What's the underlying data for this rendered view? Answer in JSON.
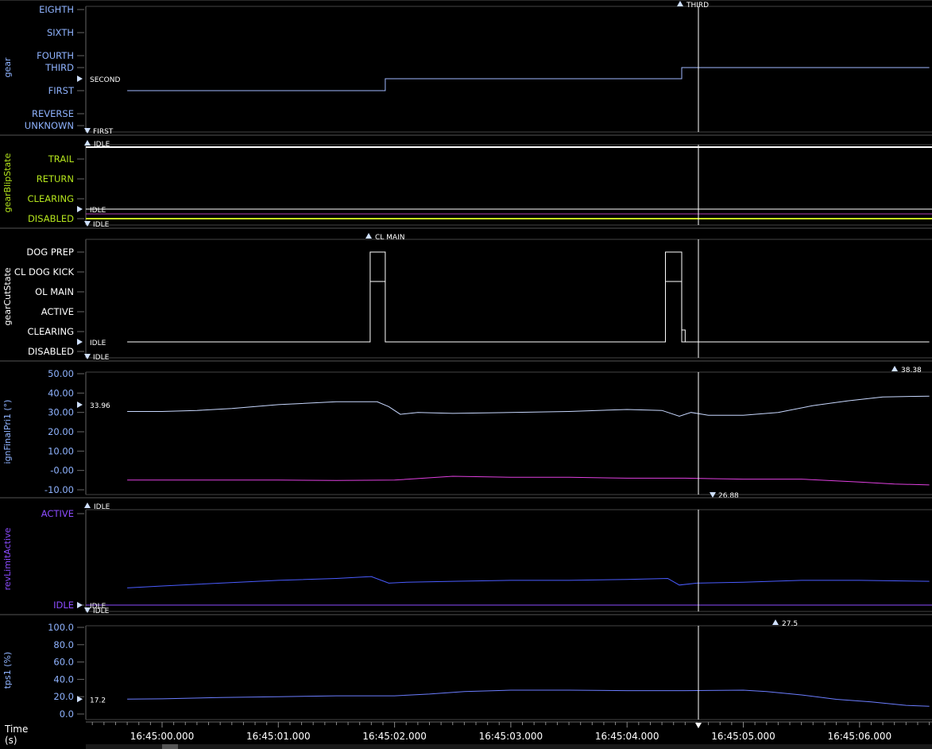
{
  "time_axis": {
    "label_line1": "Time",
    "label_line2": "(s)",
    "ticks": [
      "16:45:00.000",
      "16:45:01.000",
      "16:45:02.000",
      "16:45:03.000",
      "16:45:04.000",
      "16:45:05.000",
      "16:45:06.000"
    ]
  },
  "chart_data": [
    {
      "type": "line",
      "name": "gear",
      "ylabel": "gear",
      "label_color": "#8fb3ff",
      "y_categories": [
        "UNKNOWN",
        "REVERSE",
        "FIRST",
        "FOURTH",
        "THIRD",
        "SIXTH",
        "EIGHTH"
      ],
      "series": [
        {
          "color": "#9fb8ff",
          "x": [
            -0.3,
            1.92,
            1.92,
            4.47,
            4.47,
            6.6
          ],
          "y": [
            "FIRST",
            "FIRST",
            "SECOND",
            "SECOND",
            "THIRD",
            "THIRD"
          ]
        }
      ],
      "annotations": {
        "top": "THIRD",
        "cursor": "SECOND",
        "bottom": "FIRST"
      }
    },
    {
      "type": "line",
      "name": "gearBlipState",
      "ylabel": "gearBlipState",
      "label_color": "#b5e61d",
      "y_categories": [
        "DISABLED",
        "CLEARING",
        "RETURN",
        "TRAIL"
      ],
      "series": [
        {
          "color": "#ffffff",
          "y_constant": "IDLE"
        }
      ],
      "annotations": {
        "top": "IDLE",
        "cursor": "IDLE",
        "bottom": "IDLE"
      }
    },
    {
      "type": "line",
      "name": "gearCutState",
      "ylabel": "gearCutState",
      "label_color": "#ffffff",
      "y_categories": [
        "DISABLED",
        "CLEARING",
        "ACTIVE",
        "OL MAIN",
        "CL DOG KICK",
        "DOG PREP"
      ],
      "series": [
        {
          "color": "#ffffff",
          "x": [
            -0.3,
            1.79,
            1.79,
            1.92,
            1.92,
            4.33,
            4.33,
            4.47,
            4.47,
            6.6
          ],
          "y": [
            "IDLE",
            "IDLE",
            "DOG PREP",
            "DOG PREP",
            "IDLE",
            "IDLE",
            "DOG PREP",
            "DOG PREP",
            "IDLE",
            "IDLE"
          ]
        }
      ],
      "annotations": {
        "top": "CL MAIN",
        "cursor": "IDLE",
        "bottom": "IDLE"
      }
    },
    {
      "type": "line",
      "name": "ignFinalPri1",
      "ylabel": "ignFinalPri1 (°)",
      "label_color": "#8fb3ff",
      "ylim": [
        -10,
        50
      ],
      "yticks": [
        "50.00",
        "40.00",
        "30.00",
        "20.00",
        "10.00",
        "-0.00",
        "-10.00"
      ],
      "series": [
        {
          "color": "#c8d8ff",
          "x": [
            -0.3,
            0.0,
            0.3,
            0.6,
            1.0,
            1.5,
            1.85,
            1.95,
            2.05,
            2.2,
            2.5,
            3.0,
            3.5,
            4.0,
            4.3,
            4.45,
            4.55,
            4.7,
            5.0,
            5.3,
            5.6,
            5.9,
            6.2,
            6.6
          ],
          "y": [
            30.5,
            30.5,
            31,
            32,
            34,
            35.5,
            35.5,
            33,
            29,
            30,
            29.5,
            30,
            30.5,
            31.5,
            31,
            28,
            30,
            28.5,
            28.5,
            30,
            33.5,
            36,
            38,
            38.4
          ]
        },
        {
          "color": "#e040e0",
          "x": [
            -0.3,
            0.5,
            1.0,
            1.5,
            2.0,
            2.5,
            3.0,
            3.5,
            4.0,
            4.5,
            5.0,
            5.5,
            6.0,
            6.3,
            6.6
          ],
          "y": [
            -5,
            -5,
            -5,
            -5.2,
            -5,
            -3,
            -3.5,
            -3.5,
            -4,
            -4,
            -4.5,
            -4.5,
            -6,
            -7,
            -7.5
          ]
        }
      ],
      "annotations": {
        "top": "38.38",
        "cursor": "33.96",
        "bottom": "26.88"
      }
    },
    {
      "type": "line",
      "name": "revLimitActive",
      "ylabel": "revLimitActive",
      "label_color": "#8c4cff",
      "y_categories": [
        "IDLE",
        "ACTIVE"
      ],
      "series": [
        {
          "color": "#4a5cff",
          "x": [
            -0.3,
            0.0,
            0.5,
            1.0,
            1.5,
            1.8,
            1.95,
            2.1,
            2.5,
            3.0,
            3.5,
            4.0,
            4.35,
            4.45,
            4.6,
            5.0,
            5.5,
            6.0,
            6.6
          ],
          "y": [
            0.19,
            0.21,
            0.24,
            0.27,
            0.29,
            0.31,
            0.24,
            0.25,
            0.26,
            0.27,
            0.27,
            0.28,
            0.29,
            0.22,
            0.24,
            0.25,
            0.27,
            0.27,
            0.26
          ]
        },
        {
          "color": "#8c4cff",
          "y_constant": "IDLE"
        }
      ],
      "annotations": {
        "top": "IDLE",
        "cursor": "IDLE",
        "bottom": "IDLE"
      }
    },
    {
      "type": "line",
      "name": "tps1",
      "ylabel": "tps1 (%)",
      "label_color": "#8fb3ff",
      "ylim": [
        0,
        100
      ],
      "yticks": [
        "100.0",
        "80.0",
        "60.0",
        "40.0",
        "20.0",
        "0.0"
      ],
      "series": [
        {
          "color": "#6b7dff",
          "x": [
            -0.3,
            0.0,
            0.5,
            1.0,
            1.5,
            2.0,
            2.3,
            2.6,
            3.0,
            3.5,
            4.0,
            4.5,
            5.0,
            5.2,
            5.5,
            5.8,
            6.1,
            6.4,
            6.6
          ],
          "y": [
            17.2,
            17.5,
            19,
            20,
            21,
            21,
            23,
            26,
            27.5,
            27.5,
            27,
            27,
            27.5,
            26,
            22,
            17,
            14,
            10,
            9
          ]
        }
      ],
      "annotations": {
        "top": "27.5",
        "cursor": "17.2"
      }
    }
  ]
}
